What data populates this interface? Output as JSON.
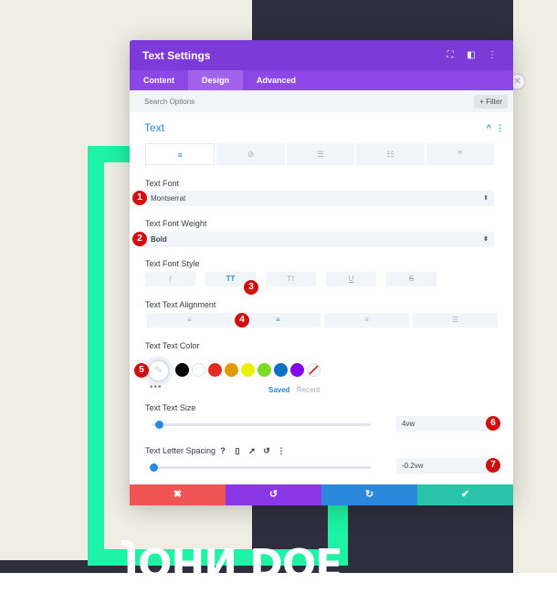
{
  "background": {
    "name_text": "JOHN DOE"
  },
  "modal": {
    "title": "Text Settings",
    "tabs": [
      "Content",
      "Design",
      "Advanced"
    ],
    "search": {
      "placeholder": "Search Options",
      "filter_label": "+ Filter"
    },
    "section_title": "Text",
    "text_font": {
      "label": "Text Font",
      "value": "Montserrat"
    },
    "text_font_weight": {
      "label": "Text Font Weight",
      "value": "Bold"
    },
    "text_font_style": {
      "label": "Text Font Style",
      "options": [
        "I",
        "TT",
        "Tт",
        "U",
        "S"
      ],
      "active": "TT"
    },
    "text_alignment": {
      "label": "Text Text Alignment",
      "active": "center"
    },
    "text_color": {
      "label": "Text Text Color",
      "swatches": [
        "#000000",
        "#ffffff",
        "#e02b20",
        "#e09900",
        "#edf000",
        "#7cda24",
        "#0c71c3",
        "#8300e9"
      ],
      "saved_label": "Saved",
      "recent_label": "Recent"
    },
    "text_size": {
      "label": "Text Text Size",
      "value": "4vw",
      "slider_level": 0.05
    },
    "letter_spacing": {
      "label": "Text Letter Spacing",
      "value": "-0.2vw",
      "slider_level": 0.02
    },
    "footer": {
      "cancel": "✖",
      "undo": "↺",
      "redo": "↻",
      "save": "✔"
    }
  },
  "markers": [
    "1",
    "2",
    "3",
    "4",
    "5",
    "6",
    "7"
  ],
  "colors": {
    "header": "#7c3bd8",
    "accent": "#2b87da",
    "mint": "#1ef2a4",
    "marker": "#d01010"
  }
}
